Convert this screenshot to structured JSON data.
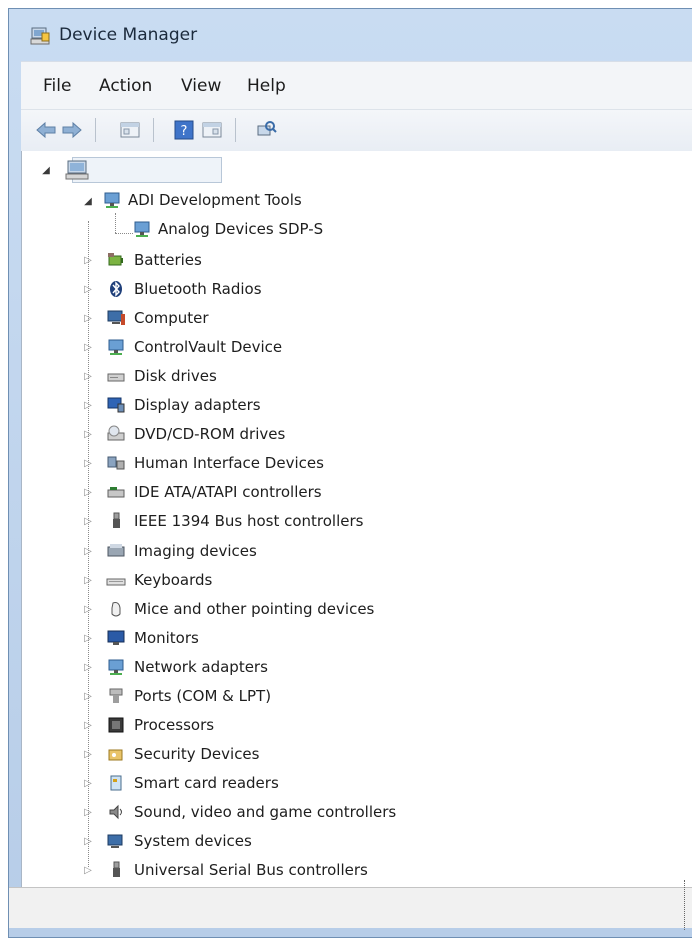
{
  "window": {
    "title": "Device Manager"
  },
  "menu": {
    "items": [
      "File",
      "Action",
      "View",
      "Help"
    ]
  },
  "toolbar": {
    "icons": [
      "back-arrow-icon",
      "forward-arrow-icon",
      "show-hide-tree-icon",
      "help-icon",
      "properties-icon",
      "scan-hardware-icon"
    ]
  },
  "tree": {
    "root": {
      "label": ""
    },
    "expanded": {
      "label": "ADI Development Tools",
      "icon": "network-device-icon",
      "children": [
        {
          "label": "Analog Devices SDP-S",
          "icon": "network-device-icon"
        }
      ]
    },
    "categories": [
      {
        "label": "Batteries",
        "icon": "battery-icon"
      },
      {
        "label": "Bluetooth Radios",
        "icon": "bluetooth-icon"
      },
      {
        "label": "Computer",
        "icon": "computer-icon"
      },
      {
        "label": "ControlVault Device",
        "icon": "network-device-icon"
      },
      {
        "label": "Disk drives",
        "icon": "disk-drive-icon"
      },
      {
        "label": "Display adapters",
        "icon": "display-adapter-icon"
      },
      {
        "label": "DVD/CD-ROM drives",
        "icon": "dvd-drive-icon"
      },
      {
        "label": "Human Interface Devices",
        "icon": "hid-icon"
      },
      {
        "label": "IDE ATA/ATAPI controllers",
        "icon": "ide-controller-icon"
      },
      {
        "label": "IEEE 1394 Bus host controllers",
        "icon": "usb-plug-icon"
      },
      {
        "label": "Imaging devices",
        "icon": "scanner-icon"
      },
      {
        "label": "Keyboards",
        "icon": "keyboard-icon"
      },
      {
        "label": "Mice and other pointing devices",
        "icon": "mouse-icon"
      },
      {
        "label": "Monitors",
        "icon": "monitor-icon"
      },
      {
        "label": "Network adapters",
        "icon": "network-device-icon"
      },
      {
        "label": "Ports (COM & LPT)",
        "icon": "port-icon"
      },
      {
        "label": "Processors",
        "icon": "processor-icon"
      },
      {
        "label": "Security Devices",
        "icon": "security-key-icon"
      },
      {
        "label": "Smart card readers",
        "icon": "smart-card-icon"
      },
      {
        "label": "Sound, video and game controllers",
        "icon": "speaker-icon"
      },
      {
        "label": "System devices",
        "icon": "system-device-icon"
      },
      {
        "label": "Universal Serial Bus controllers",
        "icon": "usb-plug-icon"
      }
    ]
  },
  "status": {
    "text": ""
  },
  "colors": {
    "titlebar": "#c2d7ef",
    "window_border": "#6f8fb3",
    "content_bg": "#ffffff",
    "label_text": "#1e1e1e"
  }
}
